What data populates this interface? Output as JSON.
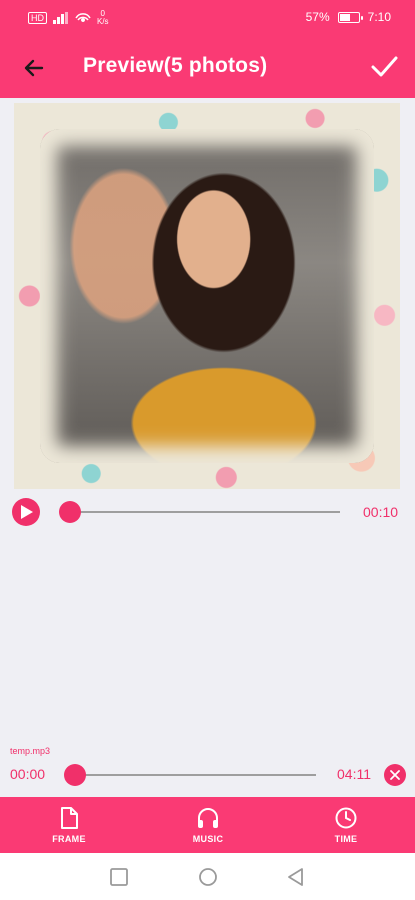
{
  "status_bar": {
    "hd_badge": "HD",
    "net_speed_top": "0",
    "net_speed_unit": "K/s",
    "battery_text": "57%",
    "battery_level": 0.57,
    "time": "7:10"
  },
  "app_bar": {
    "title": "Preview(5 photos)"
  },
  "player": {
    "current_time": "00:10",
    "progress": 0.0
  },
  "audio": {
    "file_name": "temp.mp3",
    "start_time": "00:00",
    "end_time": "04:11",
    "progress": 0.0
  },
  "tabs": [
    {
      "label": "FRAME",
      "icon": "document-icon"
    },
    {
      "label": "MUSIC",
      "icon": "headphones-icon"
    },
    {
      "label": "TIME",
      "icon": "clock-icon"
    }
  ],
  "colors": {
    "accent": "#fa3a74",
    "accent_dark": "#f0306a",
    "background": "#efeff4"
  }
}
